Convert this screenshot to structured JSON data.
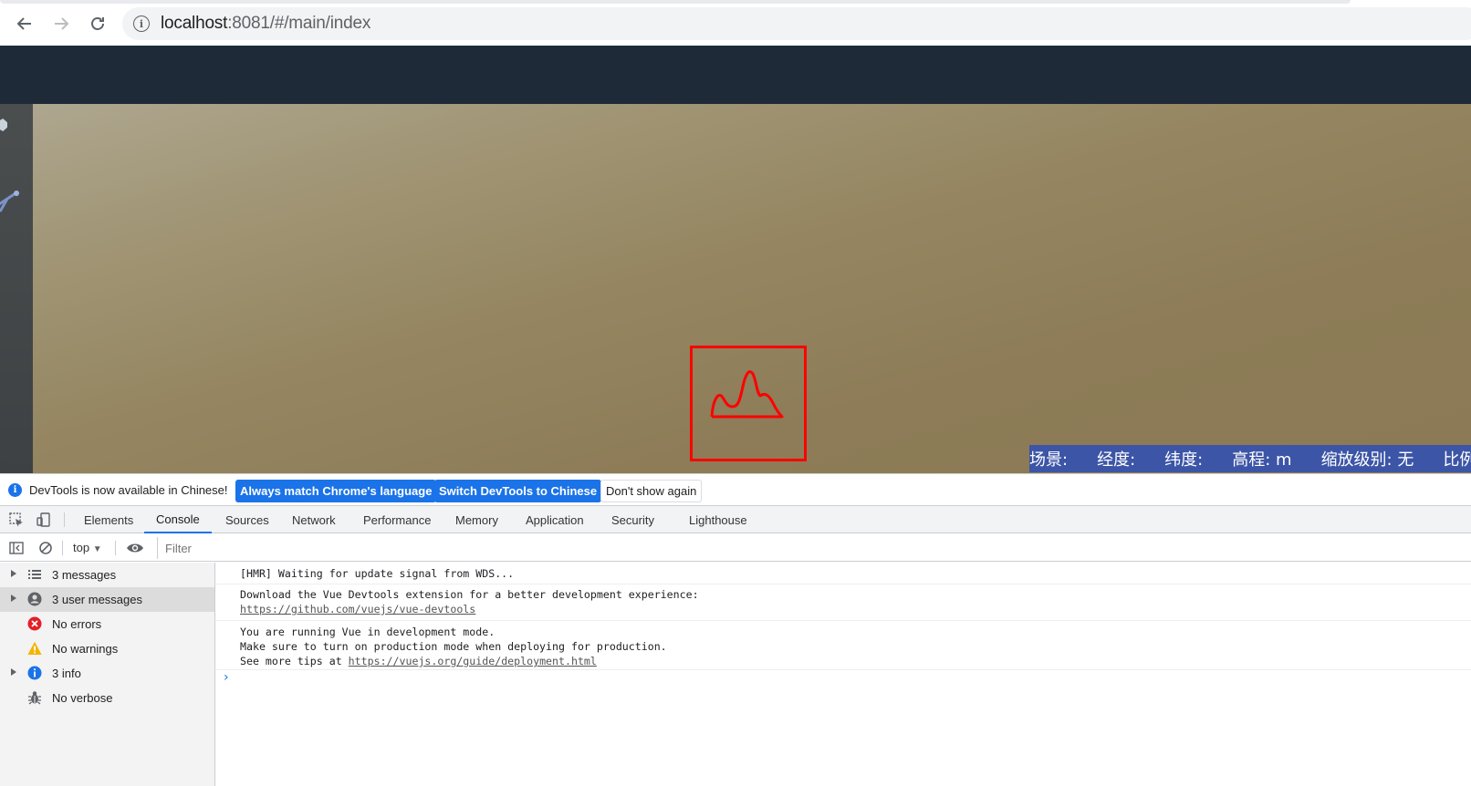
{
  "browser": {
    "url_host": "localhost",
    "url_rest": ":8081/#/main/index"
  },
  "status_bar": {
    "items": [
      "场景:",
      "经度:",
      "纬度:",
      "高程: m",
      "缩放级别: 无",
      "比例"
    ]
  },
  "infobar": {
    "message": "DevTools is now available in Chinese!",
    "btn_match": "Always match Chrome's language",
    "btn_switch": "Switch DevTools to Chinese",
    "btn_dismiss": "Don't show again"
  },
  "devtools": {
    "tabs": [
      "Elements",
      "Console",
      "Sources",
      "Network",
      "Performance",
      "Memory",
      "Application",
      "Security",
      "Lighthouse"
    ],
    "active_tab": "Console",
    "context": "top",
    "filter_placeholder": "Filter"
  },
  "sidebar": {
    "items": [
      {
        "label": "3 messages",
        "icon": "list-icon",
        "expandable": true
      },
      {
        "label": "3 user messages",
        "icon": "user-icon",
        "expandable": true,
        "selected": true
      },
      {
        "label": "No errors",
        "icon": "error-icon",
        "expandable": false
      },
      {
        "label": "No warnings",
        "icon": "warning-icon",
        "expandable": false
      },
      {
        "label": "3 info",
        "icon": "info-icon",
        "expandable": true
      },
      {
        "label": "No verbose",
        "icon": "bug-icon",
        "expandable": false
      }
    ]
  },
  "console": {
    "logs": [
      {
        "lines": [
          "[HMR] Waiting for update signal from WDS..."
        ]
      },
      {
        "lines": [
          "Download the Vue Devtools extension for a better development experience:"
        ],
        "link": "https://github.com/vuejs/vue-devtools"
      },
      {
        "lines": [
          "You are running Vue in development mode.",
          "Make sure to turn on production mode when deploying for production."
        ],
        "prefix": "See more tips at ",
        "link": "https://vuejs.org/guide/deployment.html"
      }
    ],
    "prompt": "›"
  },
  "colors": {
    "header": "#1e2a38",
    "status_bar": "#3c55a6",
    "accent": "#1a73e8",
    "annotation_box": "#ff0000"
  }
}
